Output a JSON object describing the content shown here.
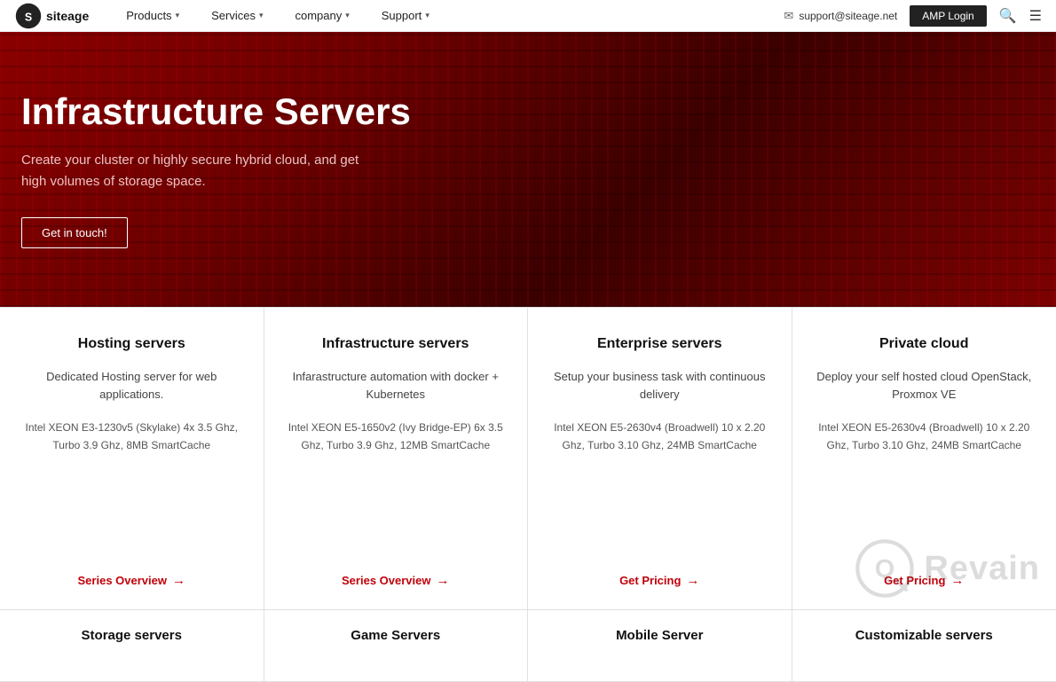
{
  "navbar": {
    "logo_text": "siteage",
    "links": [
      {
        "label": "Products",
        "has_dropdown": true
      },
      {
        "label": "Services",
        "has_dropdown": true
      },
      {
        "label": "company",
        "has_dropdown": true
      },
      {
        "label": "Support",
        "has_dropdown": true
      }
    ],
    "email": "support@siteage.net",
    "amp_login_label": "AMP Login"
  },
  "hero": {
    "title": "Infrastructure Servers",
    "subtitle_line1": "Create your cluster or highly secure hybrid cloud, and get",
    "subtitle_line2": "high volumes of storage space.",
    "cta_label": "Get in touch!"
  },
  "cards": [
    {
      "title": "Hosting servers",
      "desc": "Dedicated Hosting server for web applications.",
      "specs": "Intel XEON E3-1230v5 (Skylake)  4x 3.5 Ghz, Turbo 3.9 Ghz, 8MB SmartCache",
      "link_label": "Series Overview",
      "link_type": "series"
    },
    {
      "title": "Infrastructure servers",
      "desc": "Infarastructure automation with docker + Kubernetes",
      "specs": "Intel XEON E5-1650v2 (Ivy Bridge-EP) 6x 3.5 Ghz, Turbo 3.9 Ghz, 12MB SmartCache",
      "link_label": "Series Overview",
      "link_type": "series"
    },
    {
      "title": "Enterprise servers",
      "desc": "Setup your business task with continuous delivery",
      "specs": "Intel XEON E5-2630v4 (Broadwell) 10 x 2.20 Ghz, Turbo 3.10 Ghz, 24MB SmartCache",
      "link_label": "Get Pricing",
      "link_type": "pricing"
    },
    {
      "title": "Private cloud",
      "desc": "Deploy your self hosted cloud OpenStack, Proxmox VE",
      "specs": "Intel XEON E5-2630v4 (Broadwell) 10 x 2.20 Ghz, Turbo 3.10 Ghz, 24MB SmartCache",
      "link_label": "Get Pricing",
      "link_type": "pricing"
    }
  ],
  "bottom_cards": [
    {
      "title": "Storage servers"
    },
    {
      "title": "Game Servers"
    },
    {
      "title": "Mobile Server"
    },
    {
      "title": "Customizable servers"
    }
  ],
  "revain": {
    "text": "Revain"
  }
}
